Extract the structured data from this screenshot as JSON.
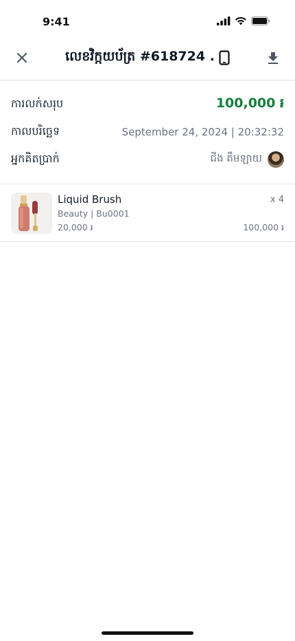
{
  "status_bar": {
    "time": "9:41"
  },
  "header": {
    "title": "លេខវិក្កយប័ត្រ #618724 ."
  },
  "summary": {
    "total_label": "ការលក់សរុប",
    "total_value": "100,000 ៛",
    "date_label": "កាលបរិច្ឆេទ",
    "date_value": "September 24, 2024 | 20:32:32",
    "cashier_label": "អ្នកគិតប្រាក់",
    "cashier_name": "ជីង គឹមឡាយ"
  },
  "items": [
    {
      "name": "Liquid Brush",
      "meta": "Beauty | Bu0001",
      "unit_price": "20,000 ៛",
      "quantity": "x 4",
      "subtotal": "100,000 ៛"
    }
  ],
  "colors": {
    "total_green": "#15803d",
    "muted_text": "#6b7280",
    "divider": "#e3e5e8"
  }
}
